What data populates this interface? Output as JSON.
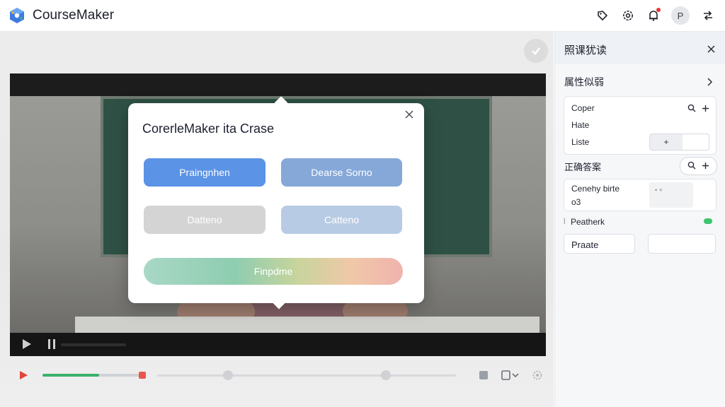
{
  "header": {
    "app_title": "CourseMaker",
    "avatar_letter": "P",
    "icons": [
      "logo-icon",
      "tag-icon",
      "settings-icon",
      "bell-icon",
      "avatar",
      "share-icon"
    ]
  },
  "modal": {
    "title": "CorerleMaker ita Crase",
    "buttons": [
      "Praingnhen",
      "Dearse Sorno",
      "Datteno",
      "Catteno",
      "Finpdme"
    ]
  },
  "panel": {
    "title": "照课犹读",
    "section_label": "属性似弱",
    "card1": {
      "line1": "Coper",
      "line2": "Hate",
      "line3": "Liste",
      "stepper": "+"
    },
    "answer_label": "正确答案",
    "card2": {
      "line1": "Cenehy birte",
      "line2": "o3",
      "thumb_text": "•      +"
    },
    "toggle_label": "Peatherk",
    "field_value": "Praate",
    "field2_value": ""
  },
  "colors": {
    "accent_blue": "#5b93e6",
    "progress_green": "#39b26a",
    "record_red": "#e8574f",
    "toggle_green": "#3cc56e"
  },
  "player": {
    "progress": 0.55
  }
}
